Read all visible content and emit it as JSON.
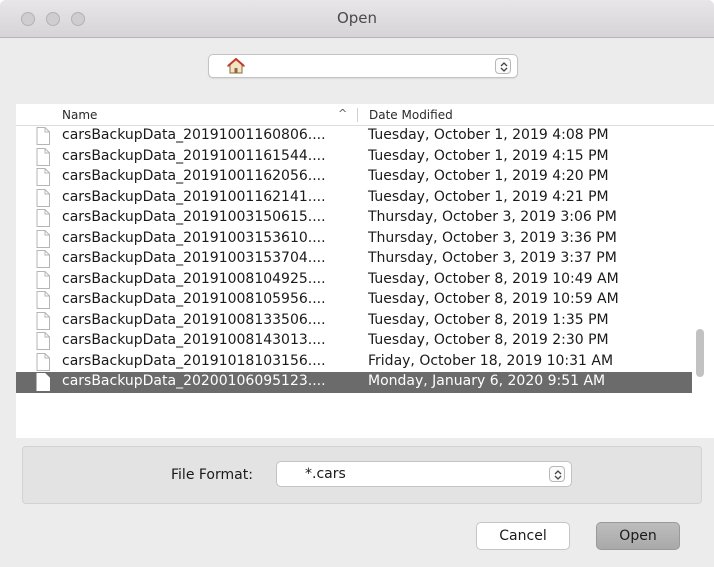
{
  "window": {
    "title": "Open"
  },
  "location": {
    "icon": "home-icon"
  },
  "list": {
    "headers": {
      "name": "Name",
      "sort_indicator": "^",
      "date": "Date Modified"
    },
    "files": [
      {
        "name": "carsBackupData_20191001160806....",
        "date": "Tuesday, October 1, 2019 4:08 PM"
      },
      {
        "name": "carsBackupData_20191001161544....",
        "date": "Tuesday, October 1, 2019 4:15 PM"
      },
      {
        "name": "carsBackupData_20191001162056....",
        "date": "Tuesday, October 1, 2019 4:20 PM"
      },
      {
        "name": "carsBackupData_20191001162141....",
        "date": "Tuesday, October 1, 2019 4:21 PM"
      },
      {
        "name": "carsBackupData_20191003150615....",
        "date": "Thursday, October 3, 2019 3:06 PM"
      },
      {
        "name": "carsBackupData_20191003153610....",
        "date": "Thursday, October 3, 2019 3:36 PM"
      },
      {
        "name": "carsBackupData_20191003153704....",
        "date": "Thursday, October 3, 2019 3:37 PM"
      },
      {
        "name": "carsBackupData_20191008104925....",
        "date": "Tuesday, October 8, 2019 10:49 AM"
      },
      {
        "name": "carsBackupData_20191008105956....",
        "date": "Tuesday, October 8, 2019 10:59 AM"
      },
      {
        "name": "carsBackupData_20191008133506....",
        "date": "Tuesday, October 8, 2019 1:35 PM"
      },
      {
        "name": "carsBackupData_20191008143013....",
        "date": "Tuesday, October 8, 2019 2:30 PM"
      },
      {
        "name": "carsBackupData_20191018103156....",
        "date": "Friday, October 18, 2019 10:31 AM"
      },
      {
        "name": "carsBackupData_20200106095123....",
        "date": "Monday, January 6, 2020 9:51 AM",
        "selected": true
      }
    ]
  },
  "format": {
    "label": "File Format:",
    "value": "*.cars"
  },
  "buttons": {
    "cancel": "Cancel",
    "open": "Open"
  },
  "colors": {
    "selection": "#6b6b6b",
    "window_bg": "#ececec"
  }
}
